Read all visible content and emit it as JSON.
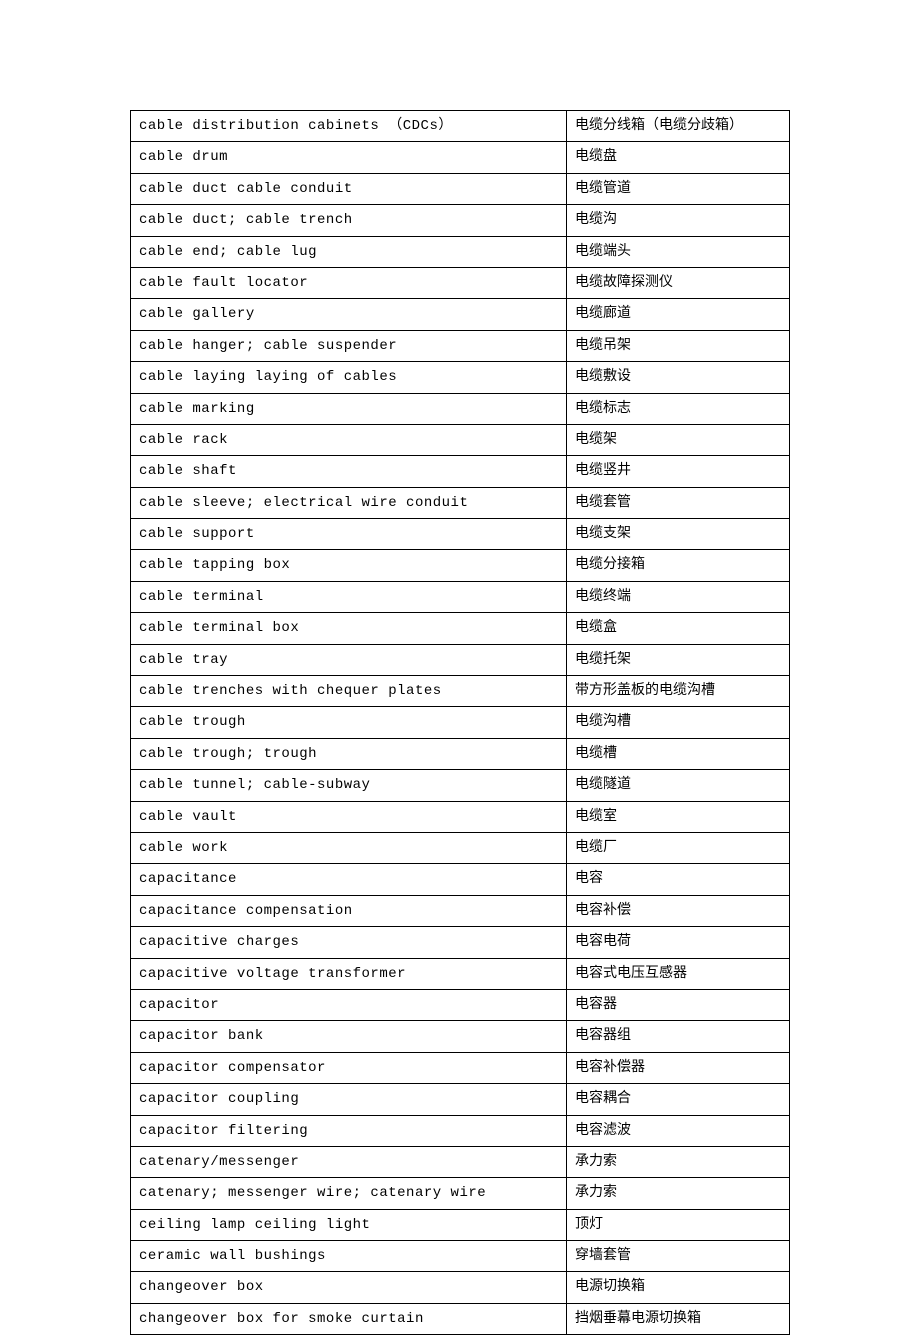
{
  "glossary": {
    "rows": [
      {
        "en": "cable distribution cabinets （CDCs）",
        "zh": "电缆分线箱（电缆分歧箱）"
      },
      {
        "en": "cable drum",
        "zh": "电缆盘"
      },
      {
        "en": "cable duct cable conduit",
        "zh": "电缆管道"
      },
      {
        "en": "cable duct; cable trench",
        "zh": "电缆沟"
      },
      {
        "en": "cable end; cable lug",
        "zh": "电缆端头"
      },
      {
        "en": "cable fault locator",
        "zh": "电缆故障探测仪"
      },
      {
        "en": "cable gallery",
        "zh": "电缆廊道"
      },
      {
        "en": "cable hanger; cable suspender",
        "zh": "电缆吊架"
      },
      {
        "en": "cable laying laying of cables",
        "zh": "电缆敷设"
      },
      {
        "en": "cable marking",
        "zh": "电缆标志"
      },
      {
        "en": "cable rack",
        "zh": "电缆架"
      },
      {
        "en": "cable shaft",
        "zh": "电缆竖井"
      },
      {
        "en": "cable sleeve; electrical wire conduit",
        "zh": "电缆套管"
      },
      {
        "en": "cable support",
        "zh": "电缆支架"
      },
      {
        "en": "cable tapping box",
        "zh": "电缆分接箱"
      },
      {
        "en": "cable terminal",
        "zh": "电缆终端"
      },
      {
        "en": "cable terminal box",
        "zh": "电缆盒"
      },
      {
        "en": "cable tray",
        "zh": "电缆托架"
      },
      {
        "en": "cable trenches with chequer plates",
        "zh": "带方形盖板的电缆沟槽"
      },
      {
        "en": "cable trough",
        "zh": "电缆沟槽"
      },
      {
        "en": "cable trough; trough",
        "zh": "电缆槽"
      },
      {
        "en": "cable tunnel; cable-subway",
        "zh": "电缆隧道"
      },
      {
        "en": "cable vault",
        "zh": "电缆室"
      },
      {
        "en": "cable work",
        "zh": "电缆厂"
      },
      {
        "en": "capacitance",
        "zh": "电容"
      },
      {
        "en": "capacitance compensation",
        "zh": "电容补偿"
      },
      {
        "en": "capacitive charges",
        "zh": "电容电荷"
      },
      {
        "en": "capacitive voltage transformer",
        "zh": "电容式电压互感器"
      },
      {
        "en": "capacitor",
        "zh": "电容器"
      },
      {
        "en": "capacitor bank",
        "zh": "电容器组"
      },
      {
        "en": "capacitor compensator",
        "zh": "电容补偿器"
      },
      {
        "en": "capacitor coupling",
        "zh": "电容耦合"
      },
      {
        "en": "capacitor filtering",
        "zh": "电容滤波"
      },
      {
        "en": "catenary/messenger",
        "zh": "承力索"
      },
      {
        "en": "catenary; messenger wire; catenary wire",
        "zh": "承力索"
      },
      {
        "en": "ceiling lamp ceiling light",
        "zh": "顶灯"
      },
      {
        "en": "ceramic wall bushings",
        "zh": "穿墙套管"
      },
      {
        "en": "changeover box",
        "zh": "电源切换箱"
      },
      {
        "en": "changeover box for smoke curtain",
        "zh": "挡烟垂幕电源切换箱"
      }
    ]
  }
}
